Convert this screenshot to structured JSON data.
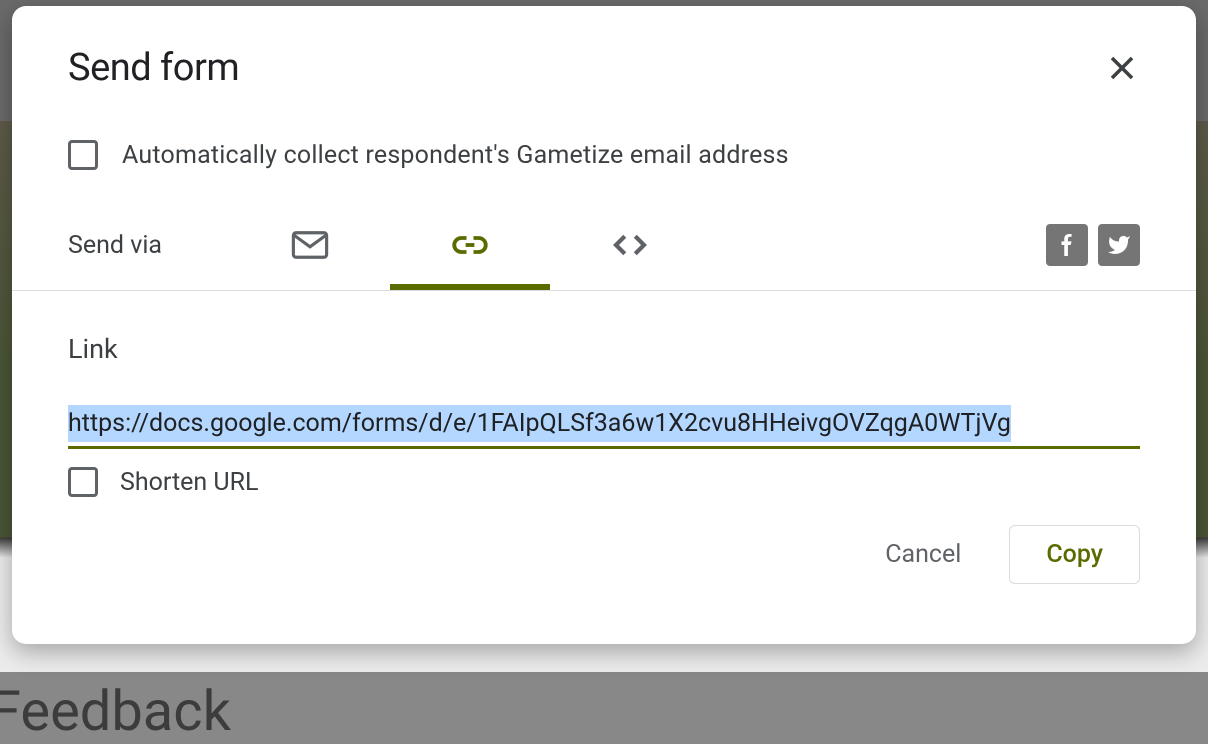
{
  "modal": {
    "title": "Send form",
    "collect_email_label": "Automatically collect respondent's Gametize email address",
    "send_via_label": "Send via",
    "link_section": {
      "label": "Link",
      "url": "https://docs.google.com/forms/d/e/1FAIpQLSf3a6w1X2cvu8HHeivgOVZqgA0WTjVg"
    },
    "shorten_url_label": "Shorten URL",
    "footer": {
      "cancel": "Cancel",
      "copy": "Copy"
    }
  },
  "background_text": "Feedback",
  "colors": {
    "accent": "#5c6b00",
    "text_primary": "#202124",
    "text_secondary": "#3c4043",
    "text_muted": "#5f6368",
    "selection": "#b3d7ff",
    "border": "#dadce0",
    "social_icon_bg": "#757575"
  }
}
